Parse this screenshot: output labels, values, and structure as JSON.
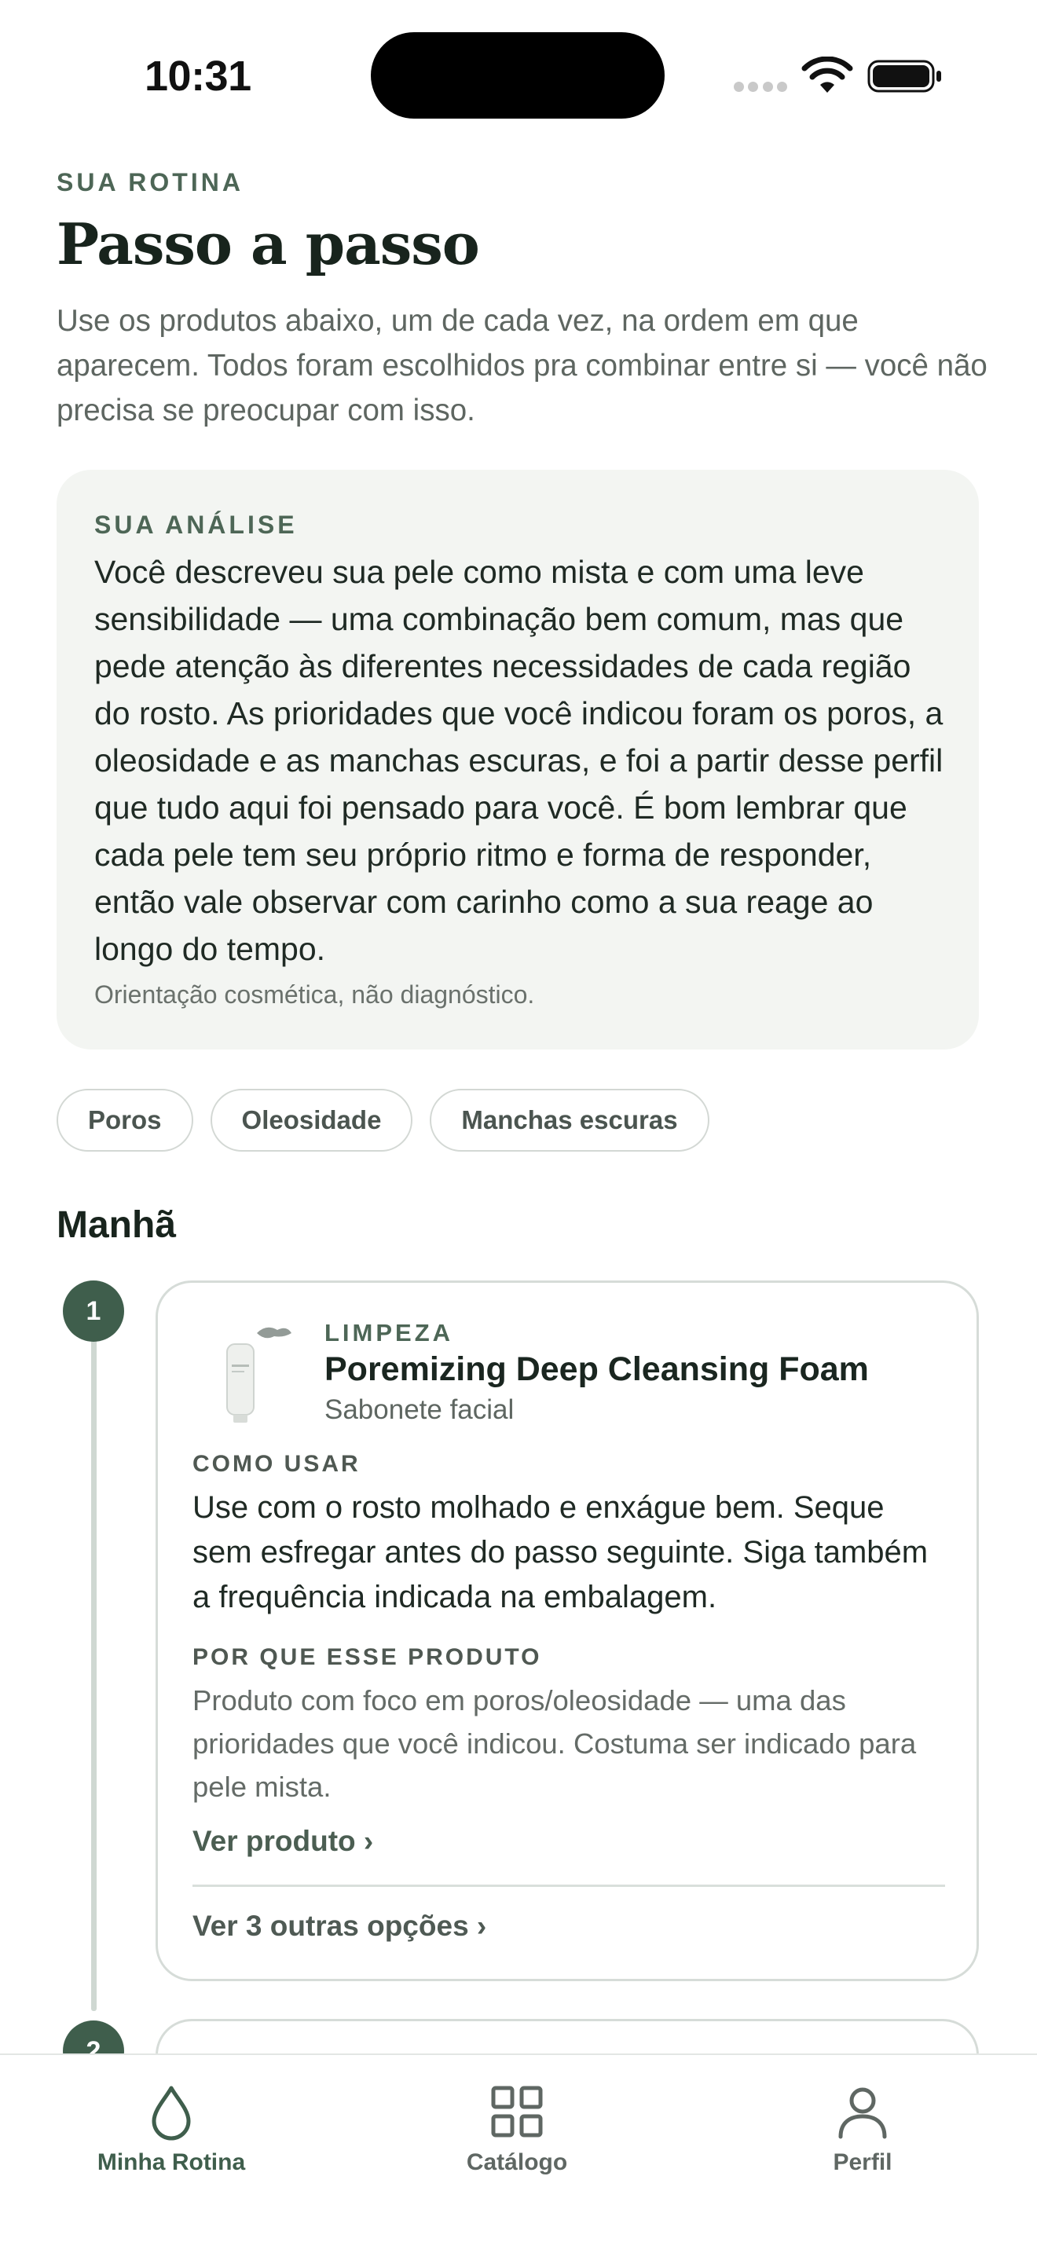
{
  "status_bar": {
    "time": "10:31"
  },
  "header": {
    "eyebrow": "SUA ROTINA",
    "title": "Passo a passo",
    "intro": "Use os produtos abaixo, um de cada vez, na ordem em que aparecem. Todos foram escolhidos pra combinar entre si — você não precisa se preocupar com isso."
  },
  "analysis": {
    "label": "SUA ANÁLISE",
    "text": "Você descreveu sua pele como mista e com uma leve sensibilidade — uma combinação bem comum, mas que pede atenção às diferentes necessidades de cada região do rosto. As prioridades que você indicou foram os poros, a oleosidade e as manchas escuras, e foi a partir desse perfil que tudo aqui foi pensado para você. É bom lembrar que cada pele tem seu próprio ritmo e forma de responder, então vale observar com carinho como a sua reage ao longo do tempo.",
    "note": "Orientação cosmética, não diagnóstico."
  },
  "chips": [
    "Poros",
    "Oleosidade",
    "Manchas escuras"
  ],
  "section": {
    "title": "Manhã"
  },
  "steps": [
    {
      "number": "1",
      "category": "LIMPEZA",
      "name": "Poremizing Deep Cleansing Foam",
      "type": "Sabonete facial",
      "how_label": "COMO USAR",
      "how_text": "Use com o rosto molhado e enxágue bem. Seque sem esfregar antes do passo seguinte. Siga também a frequência indicada na embalagem.",
      "why_label": "POR QUE ESSE PRODUTO",
      "why_text": "Produto com foco em poros/oleosidade — uma das prioridades que você indicou. Costuma ser indicado para pele mista.",
      "view_link": "Ver produto ›",
      "options_link": "Ver 3 outras opções ›"
    },
    {
      "number": "2"
    }
  ],
  "tab_bar": {
    "tabs": [
      {
        "label": "Minha Rotina",
        "icon": "drop-icon",
        "active": true
      },
      {
        "label": "Catálogo",
        "icon": "grid-icon",
        "active": false
      },
      {
        "label": "Perfil",
        "icon": "person-icon",
        "active": false
      }
    ]
  },
  "colors": {
    "accent": "#3f5e4c",
    "card_bg": "#f3f5f2",
    "eyebrow": "#4d6656"
  }
}
